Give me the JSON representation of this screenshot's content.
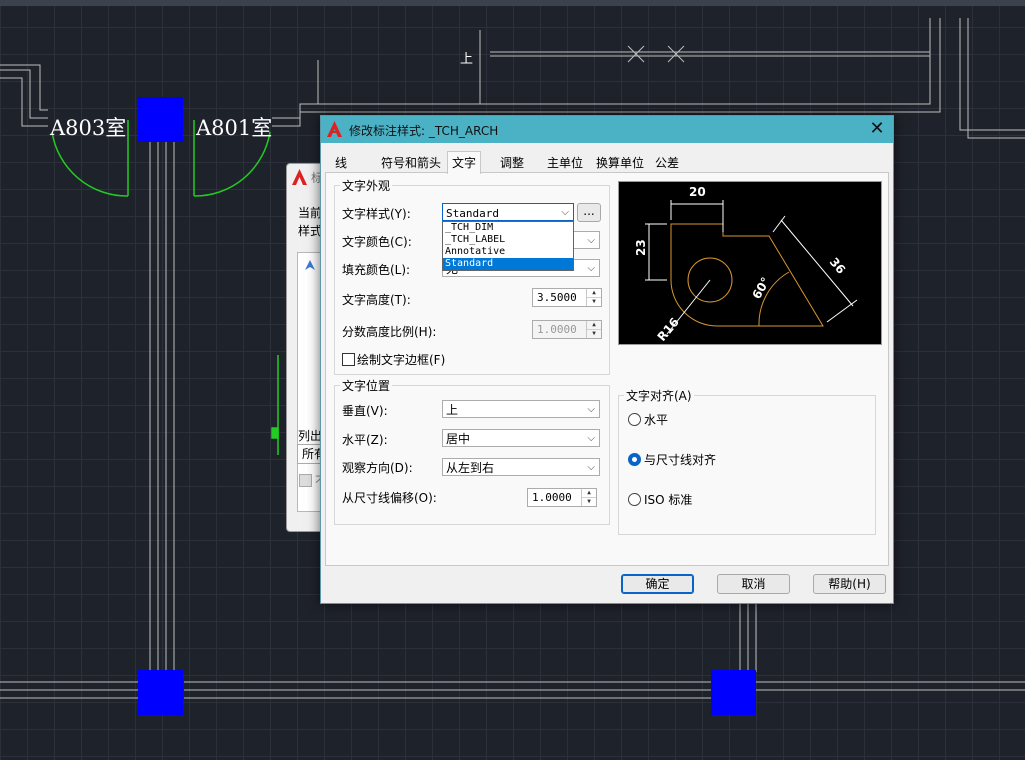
{
  "cad": {
    "room_left": "A803室",
    "room_right": "A801室",
    "marker_up": "上"
  },
  "bg_dialog": {
    "title_fragment": "标",
    "current_fragment": "当前",
    "style_fragment": "样式",
    "list_fragment": "列出",
    "all_fragment": "所有",
    "no_fragment": "不"
  },
  "dialog": {
    "title": "修改标注样式: _TCH_ARCH",
    "tabs": [
      "线",
      "符号和箭头",
      "文字",
      "调整",
      "主单位",
      "换算单位",
      "公差"
    ],
    "active_tab": "文字",
    "appearance": {
      "group": "文字外观",
      "style_label": "文字样式(Y):",
      "style_value": "Standard",
      "style_more": "...",
      "style_options": [
        "_TCH_DIM",
        "_TCH_LABEL",
        "Annotative",
        "Standard"
      ],
      "color_label": "文字颜色(C):",
      "fill_label": "填充颜色(L):",
      "fill_value": "无",
      "height_label": "文字高度(T):",
      "height_value": "3.5000",
      "fraction_label": "分数高度比例(H):",
      "fraction_value": "1.0000",
      "frame_label": "绘制文字边框(F)"
    },
    "placement": {
      "group": "文字位置",
      "vertical_label": "垂直(V):",
      "vertical_value": "上",
      "horizontal_label": "水平(Z):",
      "horizontal_value": "居中",
      "view_label": "观察方向(D):",
      "view_value": "从左到右",
      "offset_label": "从尺寸线偏移(O):",
      "offset_value": "1.0000"
    },
    "alignment": {
      "group": "文字对齐(A)",
      "options": [
        "水平",
        "与尺寸线对齐",
        "ISO 标准"
      ],
      "selected": "与尺寸线对齐"
    },
    "preview": {
      "dim_top": "20",
      "dim_left": "23",
      "dim_diag": "36",
      "angle": "60°",
      "radius": "R16"
    },
    "buttons": {
      "ok": "确定",
      "cancel": "取消",
      "help": "帮助(H)"
    }
  },
  "colors": {
    "titlebar": "#4bb2c6",
    "selection": "#0078d7",
    "marker_blue": "#0000ff",
    "preview_geometry": "#d8962e",
    "door_green": "#22cc22"
  }
}
